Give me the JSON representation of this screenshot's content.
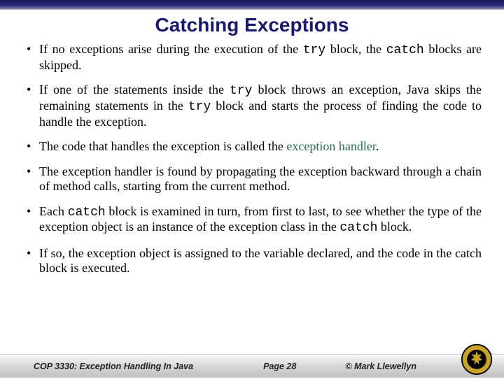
{
  "title": "Catching Exceptions",
  "bullets": {
    "b1a": "If no exceptions arise during the execution of the ",
    "b1_code1": "try",
    "b1b": " block, the ",
    "b1_code2": "catch",
    "b1c": " blocks are skipped.",
    "b2a": "If one of the statements inside the ",
    "b2_code1": "try",
    "b2b": " block throws an exception, Java skips the remaining statements in the ",
    "b2_code2": "try",
    "b2c": " block and starts the process of finding the code to handle the exception.",
    "b3a": "The code that handles the exception is called the ",
    "b3_hl": "exception handler",
    "b3b": ".",
    "b4": "The exception handler is found by propagating the exception backward through a chain of method calls, starting from the current method.",
    "b5a": "Each ",
    "b5_code1": "catch",
    "b5b": " block is examined in turn, from first to last, to see whether the type of the exception object is an instance of the exception class in the ",
    "b5_code2": "catch",
    "b5c": " block.",
    "b6": "If so, the exception object is assigned to the variable declared, and the code in the catch block is executed."
  },
  "footer": {
    "course": "COP 3330: Exception Handling In Java",
    "page": "Page 28",
    "copyright": "© Mark Llewellyn"
  }
}
